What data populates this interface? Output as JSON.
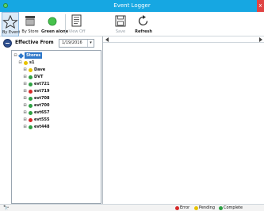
{
  "window": {
    "title": "Event Logger",
    "close_glyph": "x"
  },
  "ribbon": {
    "by_event": {
      "label": "By Event",
      "icon": "star-icon"
    },
    "by_store": {
      "label": "By Store",
      "icon": "store-icon"
    },
    "green_alone": {
      "label": "Green alone",
      "icon": "green-dot-icon"
    },
    "view_off": {
      "label": "View Off",
      "icon": "document-icon"
    },
    "save": {
      "label": "Save",
      "icon": "save-icon"
    },
    "refresh": {
      "label": "Refresh",
      "icon": "refresh-icon"
    }
  },
  "filter": {
    "label": "Effective From",
    "date_value": "1/19/2016",
    "dropdown_glyph": "▾"
  },
  "tree": {
    "root_label": "Stores",
    "group_label": "s1",
    "items": [
      {
        "label": "Dave",
        "status": "pending",
        "color": "#e8c300"
      },
      {
        "label": "DVT",
        "status": "complete",
        "color": "#2ea043"
      },
      {
        "label": "evt721",
        "status": "complete",
        "color": "#2ea043"
      },
      {
        "label": "evt719",
        "status": "error",
        "color": "#d62828"
      },
      {
        "label": "evt708",
        "status": "complete",
        "color": "#2ea043"
      },
      {
        "label": "evt700",
        "status": "complete",
        "color": "#2ea043"
      },
      {
        "label": "evt657",
        "status": "complete",
        "color": "#2ea043"
      },
      {
        "label": "evt555",
        "status": "error",
        "color": "#d62828"
      },
      {
        "label": "evt448",
        "status": "complete",
        "color": "#2ea043"
      }
    ]
  },
  "status": {
    "legend": [
      {
        "label": "Error",
        "color": "#d62828"
      },
      {
        "label": "Pending",
        "color": "#e8c300"
      },
      {
        "label": "Complete",
        "color": "#2ea043"
      }
    ]
  },
  "colors": {
    "titlebar": "#16a7e2",
    "root_highlight": "#2d77c9"
  }
}
